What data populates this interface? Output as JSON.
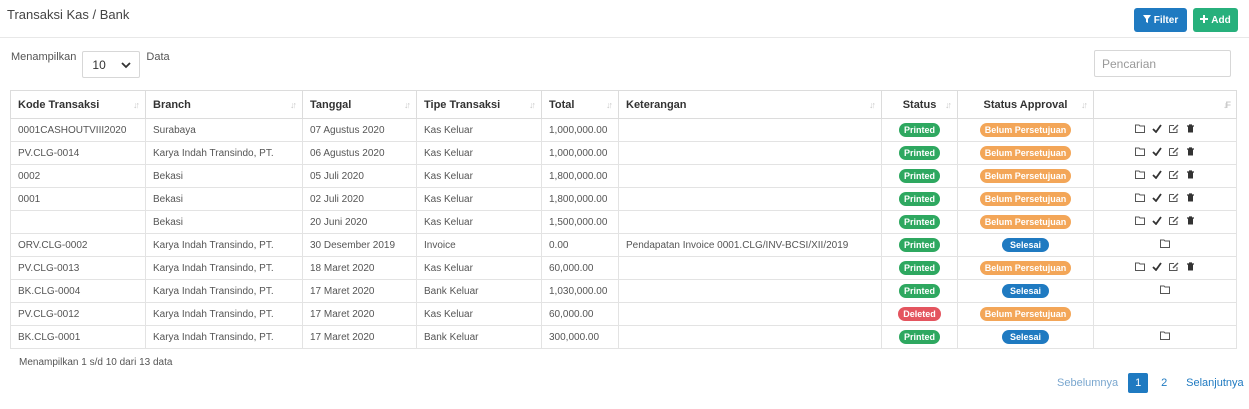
{
  "header": {
    "title": "Transaksi Kas / Bank",
    "filter_label": "Filter",
    "add_label": "Add"
  },
  "length": {
    "prefix": "Menampilkan",
    "value": "10",
    "suffix": "Data"
  },
  "search": {
    "placeholder": "Pencarian"
  },
  "columns": [
    "Kode Transaksi",
    "Branch",
    "Tanggal",
    "Tipe Transaksi",
    "Total",
    "Keterangan",
    "Status",
    "Status Approval",
    ""
  ],
  "rows": [
    {
      "kode": "0001CASHOUTVIII2020",
      "branch": "Surabaya",
      "tanggal": "07 Agustus 2020",
      "tipe": "Kas Keluar",
      "total": "1,000,000.00",
      "ket": "",
      "status": "Printed",
      "approval": "Belum Persetujuan",
      "actions": [
        "folder",
        "check",
        "edit",
        "trash"
      ]
    },
    {
      "kode": "PV.CLG-0014",
      "branch": "Karya Indah Transindo, PT.",
      "tanggal": "06 Agustus 2020",
      "tipe": "Kas Keluar",
      "total": "1,000,000.00",
      "ket": "",
      "status": "Printed",
      "approval": "Belum Persetujuan",
      "actions": [
        "folder",
        "check",
        "edit",
        "trash"
      ]
    },
    {
      "kode": "0002",
      "branch": "Bekasi",
      "tanggal": "05 Juli 2020",
      "tipe": "Kas Keluar",
      "total": "1,800,000.00",
      "ket": "",
      "status": "Printed",
      "approval": "Belum Persetujuan",
      "actions": [
        "folder",
        "check",
        "edit",
        "trash"
      ]
    },
    {
      "kode": "0001",
      "branch": "Bekasi",
      "tanggal": "02 Juli 2020",
      "tipe": "Kas Keluar",
      "total": "1,800,000.00",
      "ket": "",
      "status": "Printed",
      "approval": "Belum Persetujuan",
      "actions": [
        "folder",
        "check",
        "edit",
        "trash"
      ]
    },
    {
      "kode": "",
      "branch": "Bekasi",
      "tanggal": "20 Juni 2020",
      "tipe": "Kas Keluar",
      "total": "1,500,000.00",
      "ket": "",
      "status": "Printed",
      "approval": "Belum Persetujuan",
      "actions": [
        "folder",
        "check",
        "edit",
        "trash"
      ]
    },
    {
      "kode": "ORV.CLG-0002",
      "branch": "Karya Indah Transindo, PT.",
      "tanggal": "30 Desember 2019",
      "tipe": "Invoice",
      "total": "0.00",
      "ket": "Pendapatan Invoice 0001.CLG/INV-BCSI/XII/2019",
      "status": "Printed",
      "approval": "Selesai",
      "actions": [
        "folder"
      ]
    },
    {
      "kode": "PV.CLG-0013",
      "branch": "Karya Indah Transindo, PT.",
      "tanggal": "18 Maret 2020",
      "tipe": "Kas Keluar",
      "total": "60,000.00",
      "ket": "",
      "status": "Printed",
      "approval": "Belum Persetujuan",
      "actions": [
        "folder",
        "check",
        "edit",
        "trash"
      ]
    },
    {
      "kode": "BK.CLG-0004",
      "branch": "Karya Indah Transindo, PT.",
      "tanggal": "17 Maret 2020",
      "tipe": "Bank Keluar",
      "total": "1,030,000.00",
      "ket": "",
      "status": "Printed",
      "approval": "Selesai",
      "actions": [
        "folder"
      ]
    },
    {
      "kode": "PV.CLG-0012",
      "branch": "Karya Indah Transindo, PT.",
      "tanggal": "17 Maret 2020",
      "tipe": "Kas Keluar",
      "total": "60,000.00",
      "ket": "",
      "status": "Deleted",
      "approval": "Belum Persetujuan",
      "actions": []
    },
    {
      "kode": "BK.CLG-0001",
      "branch": "Karya Indah Transindo, PT.",
      "tanggal": "17 Maret 2020",
      "tipe": "Bank Keluar",
      "total": "300,000.00",
      "ket": "",
      "status": "Printed",
      "approval": "Selesai",
      "actions": [
        "folder"
      ]
    }
  ],
  "info": "Menampilkan 1 s/d 10 dari 13 data",
  "pagination": {
    "prev": "Sebelumnya",
    "pages": [
      "1",
      "2"
    ],
    "active": "1",
    "next": "Selanjutnya"
  },
  "colors": {
    "primary": "#1f7ac1",
    "success": "#27b07c",
    "printed": "#2ea860",
    "deleted": "#e4555f",
    "pending": "#f3a658"
  }
}
